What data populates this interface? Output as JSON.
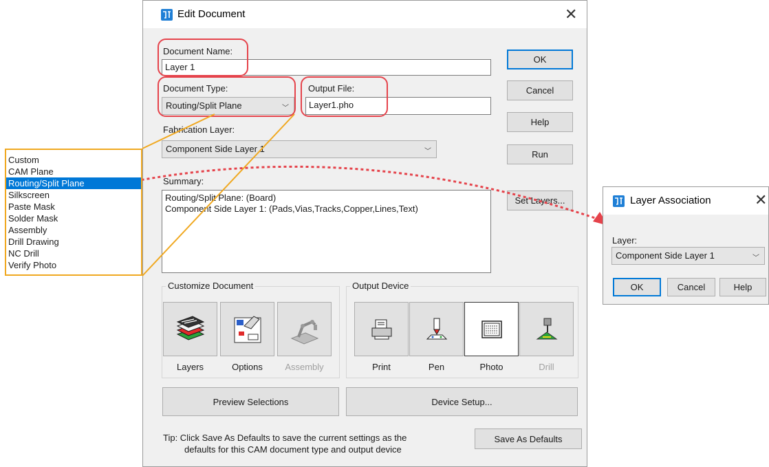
{
  "edit_dialog": {
    "title": "Edit Document",
    "document_name_label": "Document Name:",
    "document_name_value": "Layer 1",
    "document_type_label": "Document Type:",
    "document_type_value": "Routing/Split Plane",
    "output_file_label": "Output File:",
    "output_file_value": "Layer1.pho",
    "fabrication_layer_label": "Fabrication Layer:",
    "fabrication_layer_value": "Component Side Layer 1",
    "summary_label": "Summary:",
    "summary_lines": [
      "Routing/Split Plane: (Board)",
      "Component Side Layer 1: (Pads,Vias,Tracks,Copper,Lines,Text)"
    ],
    "buttons": {
      "ok": "OK",
      "cancel": "Cancel",
      "help": "Help",
      "run": "Run",
      "set_layers": "Set Layers..."
    },
    "customize_group_label": "Customize Document",
    "customize_tiles": [
      {
        "label": "Layers",
        "icon": "layers-stack-icon",
        "enabled": true
      },
      {
        "label": "Options",
        "icon": "options-hand-icon",
        "enabled": true
      },
      {
        "label": "Assembly",
        "icon": "assembly-robot-arm-icon",
        "enabled": false
      }
    ],
    "output_group_label": "Output Device",
    "output_tiles": [
      {
        "label": "Print",
        "icon": "printer-icon",
        "enabled": true,
        "selected": false
      },
      {
        "label": "Pen",
        "icon": "pen-plotter-icon",
        "enabled": true,
        "selected": false
      },
      {
        "label": "Photo",
        "icon": "photo-plotter-icon",
        "enabled": true,
        "selected": true
      },
      {
        "label": "Drill",
        "icon": "drill-icon",
        "enabled": false,
        "selected": false
      }
    ],
    "preview_button": "Preview Selections",
    "device_setup_button": "Device Setup...",
    "tip_line1": "Tip: Click Save As Defaults to save the current settings as the",
    "tip_line2": "defaults for this CAM document type and output device",
    "save_defaults_button": "Save As Defaults"
  },
  "document_type_list": {
    "items": [
      "Custom",
      "CAM Plane",
      "Routing/Split Plane",
      "Silkscreen",
      "Paste Mask",
      "Solder Mask",
      "Assembly",
      "Drill Drawing",
      "NC Drill",
      "Verify Photo"
    ],
    "selected_index": 2
  },
  "layer_dialog": {
    "title": "Layer Association",
    "layer_label": "Layer:",
    "layer_value": "Component Side Layer 1",
    "buttons": {
      "ok": "OK",
      "cancel": "Cancel",
      "help": "Help"
    }
  },
  "colors": {
    "highlight_red": "#e5434b",
    "callout_orange": "#f0a820",
    "selection_blue": "#0078d7"
  }
}
